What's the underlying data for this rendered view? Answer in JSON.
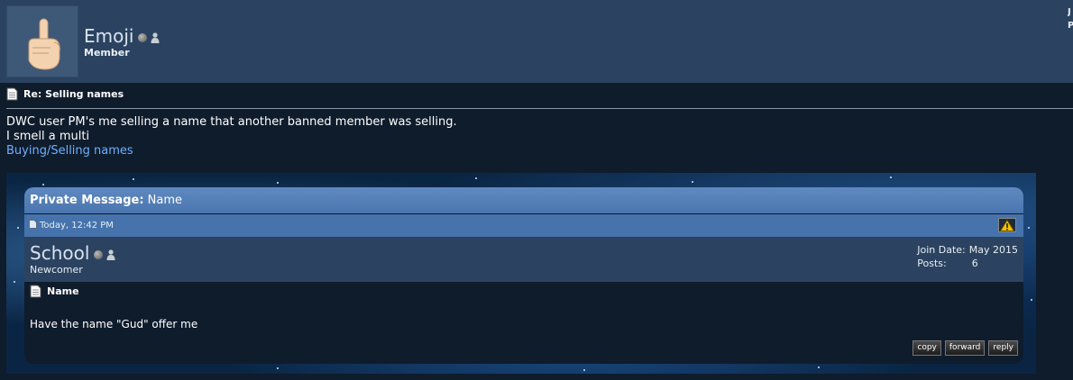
{
  "post_author": {
    "username": "Emoji",
    "usertitle": "Member",
    "avatar_icon": "middle-finger-hand-icon",
    "status_icon": "offline-status-icon",
    "profile_icon": "user-profile-icon"
  },
  "corner_text": "J P",
  "post": {
    "title": "Re: Selling names",
    "body_lines": [
      "DWC user PM's me selling a name that another banned member was selling.",
      "I smell a multi"
    ],
    "link_text": "Buying/Selling names"
  },
  "embedded_pm": {
    "header_label": "Private Message:",
    "header_subject": "Name",
    "date": "Today, 12:42 PM",
    "sender": {
      "username": "School",
      "usertitle": "Newcomer",
      "join_date_label": "Join Date:",
      "join_date": "May 2015",
      "posts_label": "Posts:",
      "posts": "6"
    },
    "title": "Name",
    "message": "Have the name \"Gud\" offer me",
    "actions": {
      "copy": "copy",
      "forward": "forward",
      "reply": "reply"
    }
  },
  "colors": {
    "page_bg": "#0f1c2c",
    "header_bg": "#2b4360",
    "link": "#6fb0ff",
    "pm_header": "#5f89c0"
  }
}
